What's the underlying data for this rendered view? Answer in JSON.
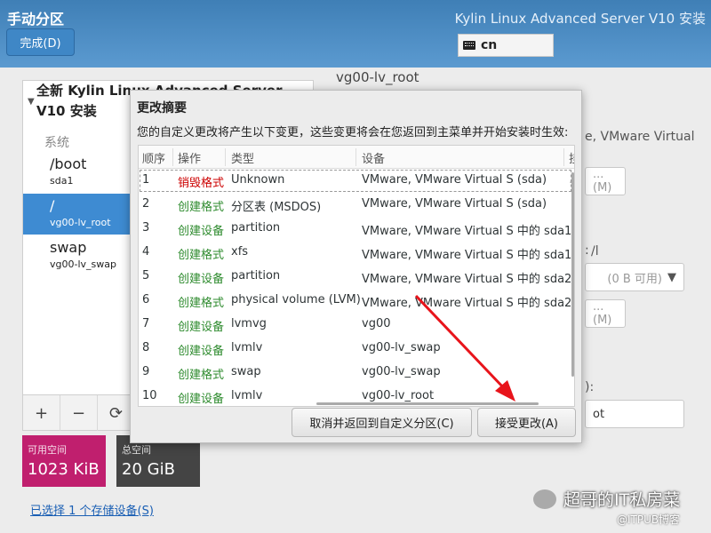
{
  "header": {
    "title": "手动分区",
    "subtitle": "Kylin Linux Advanced Server V10 安装",
    "done_label": "完成(D)",
    "keyboard_layout": "cn"
  },
  "left_panel": {
    "group_title": "全新 Kylin Linux Advanced Server V10 安装",
    "system_label": "系统",
    "mounts": [
      {
        "mount": "/boot",
        "device": "sda1",
        "selected": false
      },
      {
        "mount": "/",
        "device": "vg00-lv_root",
        "selected": true
      },
      {
        "mount": "swap",
        "device": "vg00-lv_swap",
        "selected": false
      }
    ],
    "tools": [
      "+",
      "−",
      "⟳"
    ]
  },
  "space": {
    "available_label": "可用空间",
    "available_value": "1023 KiB",
    "total_label": "总空间",
    "total_value": "20 GiB"
  },
  "storage_link": "已选择 1 个存储设备(S)",
  "right_panel": {
    "partition_name": "vg00-lv_root",
    "device_text": "e, VMware Virtual",
    "modify_btn_1": "...(M)",
    "colon_1": ":",
    "free_space": "(0 B 可用)",
    "modify_btn_2": "...(M)",
    "colon_2": "):",
    "root_field": "ot",
    "label_frag": "/l"
  },
  "dialog": {
    "title": "更改摘要",
    "description": "您的自定义更改将产生以下变更，这些变更将会在您返回到主菜单并开始安装时生效:",
    "columns": [
      "顺序",
      "操作",
      "类型",
      "设备",
      "挂"
    ],
    "rows": [
      {
        "order": "1",
        "action": "销毁格式",
        "kind": "delete",
        "type": "Unknown",
        "device": "VMware, VMware Virtual S (sda)"
      },
      {
        "order": "2",
        "action": "创建格式",
        "kind": "create",
        "type": "分区表 (MSDOS)",
        "device": "VMware, VMware Virtual S (sda)"
      },
      {
        "order": "3",
        "action": "创建设备",
        "kind": "create",
        "type": "partition",
        "device": "VMware, VMware Virtual S 中的 sda1"
      },
      {
        "order": "4",
        "action": "创建格式",
        "kind": "create",
        "type": "xfs",
        "device": "VMware, VMware Virtual S 中的 sda1"
      },
      {
        "order": "5",
        "action": "创建设备",
        "kind": "create",
        "type": "partition",
        "device": "VMware, VMware Virtual S 中的 sda2"
      },
      {
        "order": "6",
        "action": "创建格式",
        "kind": "create",
        "type": "physical volume (LVM)",
        "device": "VMware, VMware Virtual S 中的 sda2"
      },
      {
        "order": "7",
        "action": "创建设备",
        "kind": "create",
        "type": "lvmvg",
        "device": "vg00"
      },
      {
        "order": "8",
        "action": "创建设备",
        "kind": "create",
        "type": "lvmlv",
        "device": "vg00-lv_swap"
      },
      {
        "order": "9",
        "action": "创建格式",
        "kind": "create",
        "type": "swap",
        "device": "vg00-lv_swap"
      },
      {
        "order": "10",
        "action": "创建设备",
        "kind": "create",
        "type": "lvmlv",
        "device": "vg00-lv_root"
      }
    ],
    "cancel_label": "取消并返回到自定义分区(C)",
    "accept_label": "接受更改(A)"
  },
  "colors": {
    "header": "#4a8cc4",
    "selected": "#3e8bd2",
    "available_space": "#c01f6e",
    "total_space": "#444444",
    "destroy": "#cc0000",
    "create": "#2e8b2e",
    "annotation_arrow": "#e8141b"
  },
  "watermark": {
    "primary": "超哥的IT私房菜",
    "secondary": "@ITPUB博客"
  }
}
